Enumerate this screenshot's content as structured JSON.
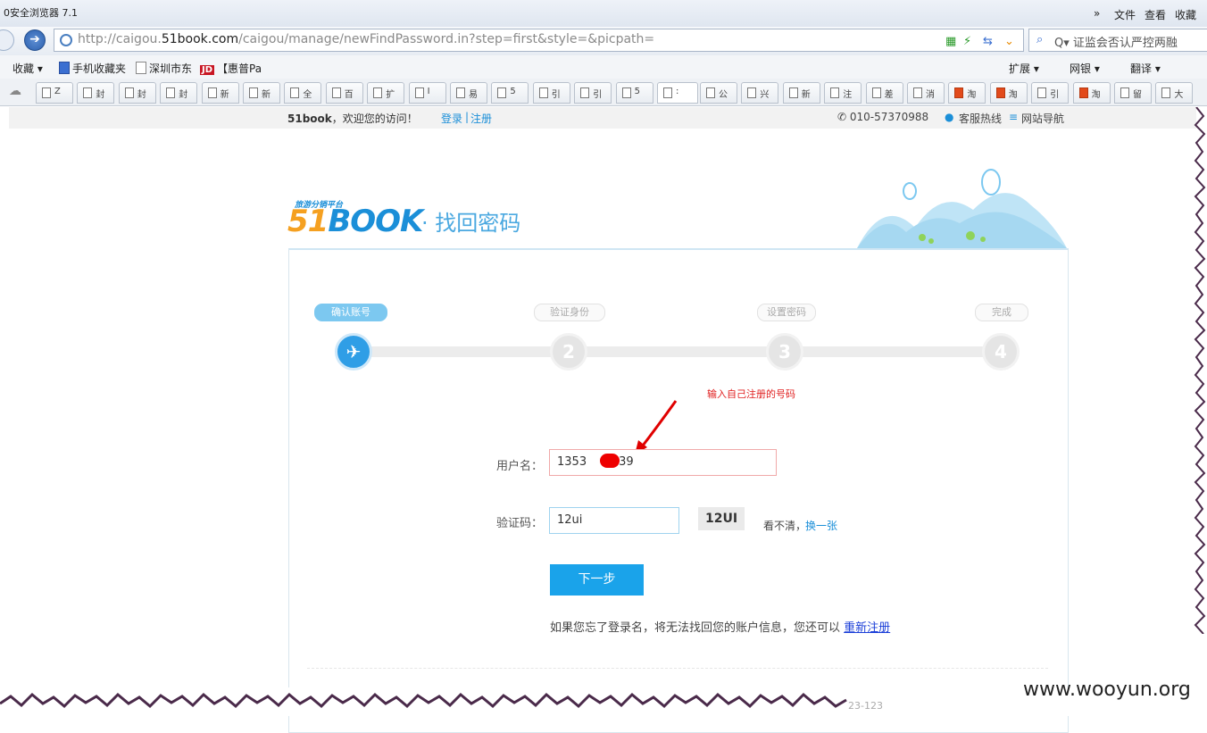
{
  "browser": {
    "title": "0安全浏览器 7.1",
    "menu": [
      "»",
      "文件",
      "查看",
      "收藏"
    ],
    "url_prefix": "http://caigou.",
    "url_domain": "51book.com",
    "url_suffix": "/caigou/manage/newFindPassword.in?step=first&style=&picpath=",
    "search_text": "Q▾ 证监会否认严控两融",
    "favorites": [
      "收藏 ▾",
      "手机收藏夹",
      "深圳市东",
      "【惠普Pa"
    ],
    "jd_label": "JD",
    "extras": [
      "扩展 ▾",
      "网银 ▾",
      "翻译 ▾"
    ],
    "tabs": [
      "Z",
      "封",
      "封",
      "封",
      "新",
      "新",
      "全",
      "百",
      "扩",
      "I",
      "易",
      "5",
      "引",
      "引",
      "5",
      ":",
      "公",
      "兴",
      "新",
      "注",
      "差",
      "消",
      "淘",
      "淘",
      "引",
      "淘",
      "留",
      "大"
    ]
  },
  "site_bar": {
    "welcome_brand": "51book",
    "welcome_text": "，欢迎您的访问！",
    "login": "登录",
    "separator": "|",
    "register": "注册",
    "phone": "✆ 010-57370988",
    "service": "客服热线",
    "sitenav": "网站导航"
  },
  "logo": {
    "tagline": "旅游分销平台",
    "brand_one": "51",
    "brand_rest": "BOOK",
    "page_title": "· 找回密码"
  },
  "steps": [
    {
      "label": "确认账号",
      "number": "✈",
      "active": true
    },
    {
      "label": "验证身份",
      "number": "2",
      "active": false
    },
    {
      "label": "设置密码",
      "number": "3",
      "active": false
    },
    {
      "label": "完成",
      "number": "4",
      "active": false
    }
  ],
  "annotation": "输入自己注册的号码",
  "form": {
    "username_label": "用户名：",
    "username_value_start": "1353",
    "username_value_end": "39",
    "captcha_label": "验证码：",
    "captcha_value": "12ui",
    "captcha_image_text": "12UI",
    "captcha_help": "看不清，",
    "captcha_refresh": "换一张",
    "next_button": "下一步"
  },
  "footer": {
    "text": "如果您忘了登录名，将无法找回您的账户信息，您还可以",
    "link": "重新注册",
    "partial": "23-123"
  },
  "watermark": "www.wooyun.org",
  "colors": {
    "accent": "#1aa3ea",
    "annotation": "#e02020"
  }
}
